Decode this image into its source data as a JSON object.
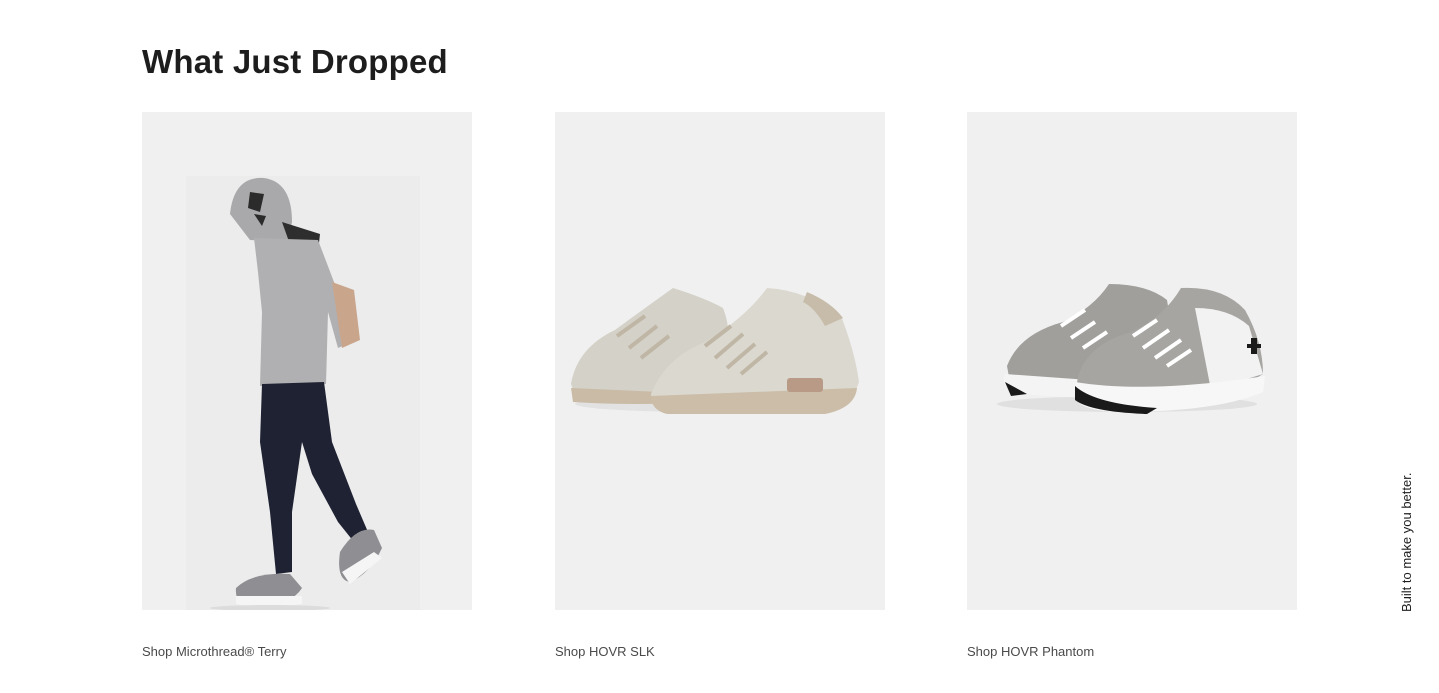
{
  "section": {
    "title": "What Just Dropped"
  },
  "tiles": [
    {
      "link_label": "Shop Microthread® Terry",
      "image": "model-in-hoodie-and-joggers"
    },
    {
      "link_label": "Shop HOVR SLK",
      "image": "beige-knit-running-shoes"
    },
    {
      "link_label": "Shop HOVR Phantom",
      "image": "grey-white-running-shoes"
    }
  ],
  "tagline": "Built to make you better.",
  "colors": {
    "tile_background": "#f0f0f0",
    "heading": "#1d1d1d",
    "link_text": "#4a4a4a"
  }
}
